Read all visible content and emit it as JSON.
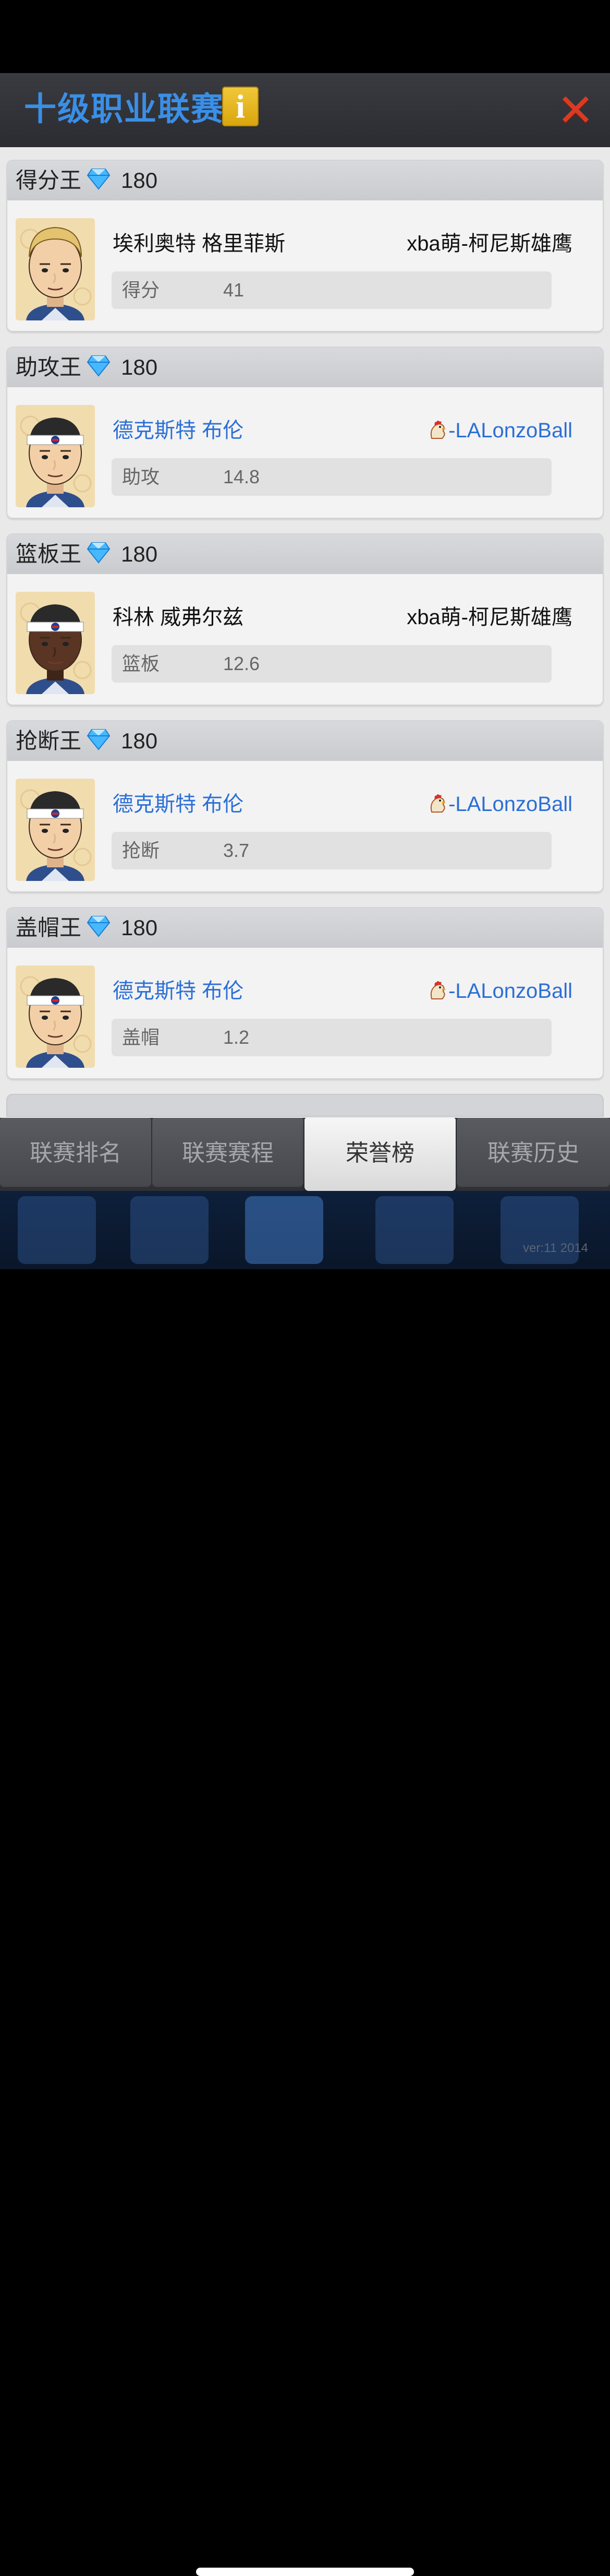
{
  "header": {
    "title": "十级职业联赛",
    "info_glyph": "i",
    "close_glyph": "✕"
  },
  "cards": [
    {
      "title": "得分王",
      "reward": "180",
      "player": "埃利奥特 格里菲斯",
      "player_link": false,
      "team": "xba萌-柯尼斯雄鹰",
      "team_link": false,
      "stat_label": "得分",
      "stat_value": "41",
      "skin": "light",
      "hair": "blond",
      "headband": false
    },
    {
      "title": "助攻王",
      "reward": "180",
      "player": "德克斯特 布伦",
      "player_link": true,
      "team": "-LALonzoBall",
      "team_link": true,
      "stat_label": "助攻",
      "stat_value": "14.8",
      "skin": "light",
      "hair": "dark",
      "headband": true
    },
    {
      "title": "篮板王",
      "reward": "180",
      "player": "科林 威弗尔兹",
      "player_link": false,
      "team": "xba萌-柯尼斯雄鹰",
      "team_link": false,
      "stat_label": "篮板",
      "stat_value": "12.6",
      "skin": "dark",
      "hair": "dark",
      "headband": true
    },
    {
      "title": "抢断王",
      "reward": "180",
      "player": "德克斯特 布伦",
      "player_link": true,
      "team": "-LALonzoBall",
      "team_link": true,
      "stat_label": "抢断",
      "stat_value": "3.7",
      "skin": "light",
      "hair": "dark",
      "headband": true
    },
    {
      "title": "盖帽王",
      "reward": "180",
      "player": "德克斯特 布伦",
      "player_link": true,
      "team": "-LALonzoBall",
      "team_link": true,
      "stat_label": "盖帽",
      "stat_value": "1.2",
      "skin": "light",
      "hair": "dark",
      "headband": true
    }
  ],
  "tabs": [
    {
      "label": "联赛排名",
      "active": false
    },
    {
      "label": "联赛赛程",
      "active": false
    },
    {
      "label": "荣誉榜",
      "active": true
    },
    {
      "label": "联赛历史",
      "active": false
    }
  ],
  "footer": {
    "version": "ver:11  2014"
  },
  "colors": {
    "accent": "#3a8fe6",
    "link": "#2b6fd6",
    "close": "#d83b24",
    "info": "#e8b820"
  }
}
